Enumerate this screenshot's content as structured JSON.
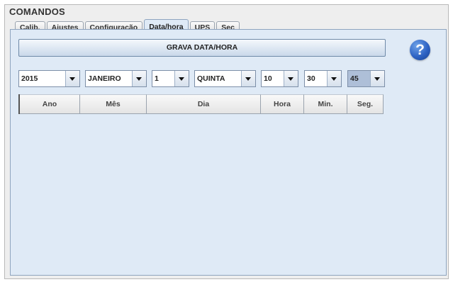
{
  "panel": {
    "title": "COMANDOS"
  },
  "tabs": [
    {
      "label": "Calib."
    },
    {
      "label": "Ajustes"
    },
    {
      "label": "Configuração"
    },
    {
      "label": "Data/hora",
      "active": true
    },
    {
      "label": "UPS"
    },
    {
      "label": "Sec"
    }
  ],
  "actions": {
    "grava_label": "GRAVA DATA/HORA",
    "help_glyph": "?"
  },
  "selectors": {
    "ano": "2015",
    "mes": "JANEIRO",
    "dia": "1",
    "dia_semana": "QUINTA",
    "hora": "10",
    "minuto": "30",
    "segundo": "45"
  },
  "table": {
    "headers": [
      "Ano",
      "Mês",
      "Dia",
      "Hora",
      "Min.",
      "Seg."
    ],
    "rows": []
  },
  "colors": {
    "accent": "#2e63c4",
    "tab_active_bg": "#dfeaf6",
    "selected_combo": "#aebfd8"
  }
}
